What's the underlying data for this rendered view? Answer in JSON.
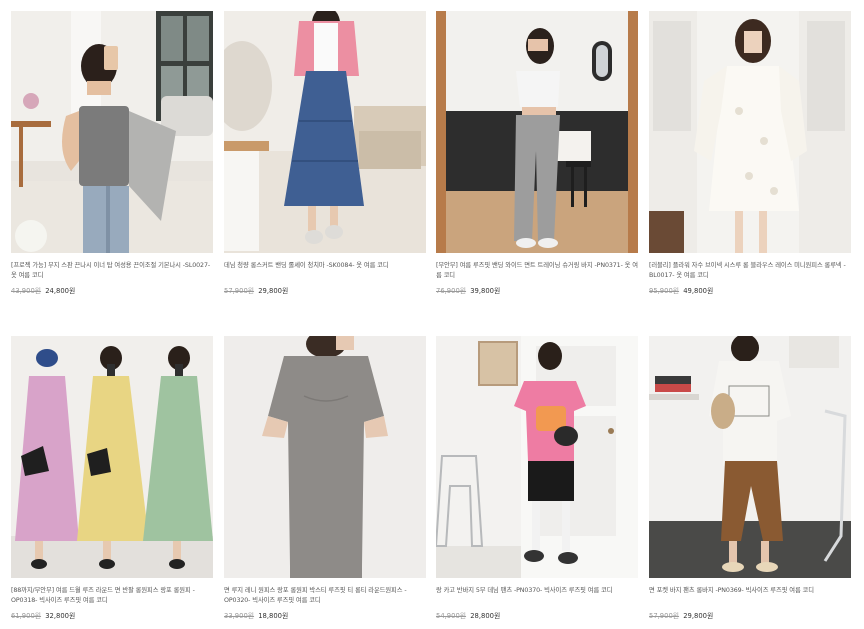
{
  "products": [
    {
      "title": "[프로젝 가능] 무지 스판 끈나시 이너 탑 여성용 끈이조절 기본나시 -SL0027- 옷 여름 코디",
      "original_price": "43,900원",
      "sale_price": "24,800원"
    },
    {
      "title": "데님 청량 롱스커트 밴딩 롤셰이 청치마 -SK0084- 옷 여름 코디",
      "original_price": "57,900원",
      "sale_price": "29,800원"
    },
    {
      "title": "[무안무] 여름 루즈핏 밴딩 와이드 면트 트레이닝 슈거링 바지 -PN0371- 옷 여름 코디",
      "original_price": "76,900원",
      "sale_price": "39,800원"
    },
    {
      "title": "[러블리] 플라워 자수 브이넥 시스루 롱 블라우스 레이스 미니원피스 롱루넥 -BL0017- 옷 여름 코디",
      "original_price": "95,900원",
      "sale_price": "49,800원"
    },
    {
      "title": "[88까지/무안무] 여름 드월 루즈 라운드 면 반팔 롱원피스 랑포 롱원피 -OP0318- 빅사이즈 루즈핏 여름 코디",
      "original_price": "61,900원",
      "sale_price": "32,800원"
    },
    {
      "title": "면 루지 레니 원피스 랑포 롱원피 박스티 루즈핏 티 롱티 라운드원피스 -OP0320- 빅사이즈 루즈핏 여름 코디",
      "original_price": "33,900원",
      "sale_price": "18,800원"
    },
    {
      "title": "랑 카고 반바지 5부 데님 팬츠 -PN0370- 빅사이즈 루즈핏 여름 코디",
      "original_price": "54,900원",
      "sale_price": "28,800원"
    },
    {
      "title": "면 포켓 바지 팬츠 롱바지 -PN0369- 빅사이즈 루즈핏 여름 코디",
      "original_price": "57,900원",
      "sale_price": "29,800원"
    }
  ]
}
